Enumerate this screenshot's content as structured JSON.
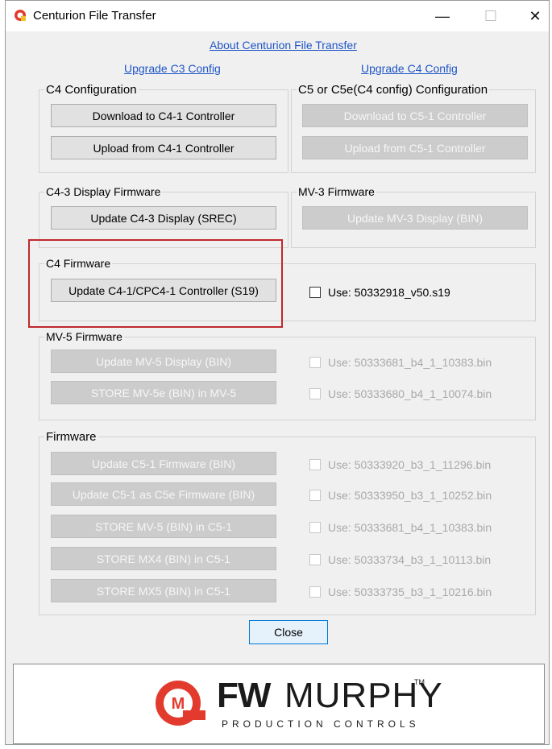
{
  "window": {
    "title": "Centurion File Transfer",
    "min_symbol": "—",
    "max_symbol": "☐",
    "close_symbol": "✕"
  },
  "links": {
    "about": "About Centurion File Transfer",
    "upgrade_c3": "Upgrade C3 Config",
    "upgrade_c4": "Upgrade C4 Config"
  },
  "c4_config": {
    "legend": "C4 Configuration",
    "download": "Download to C4-1 Controller",
    "upload": "Upload from C4-1 Controller"
  },
  "c5_config": {
    "legend": "C5 or C5e(C4 config) Configuration",
    "download": "Download to C5-1 Controller",
    "upload": "Upload from C5-1 Controller"
  },
  "c43_display": {
    "legend": "C4-3 Display Firmware",
    "update": "Update C4-3 Display (SREC)"
  },
  "mv3": {
    "legend": "MV-3 Firmware",
    "update": "Update MV-3 Display (BIN)"
  },
  "c4_firmware": {
    "legend": "C4 Firmware",
    "update": "Update C4-1/CPC4-1 Controller (S19)",
    "use": "Use: 50332918_v50.s19"
  },
  "mv5": {
    "legend": "MV-5 Firmware",
    "update": "Update MV-5 Display (BIN)",
    "update_use": "Use: 50333681_b4_1_10383.bin",
    "store": "STORE MV-5e (BIN) in MV-5",
    "store_use": "Use: 50333680_b4_1_10074.bin"
  },
  "firmware": {
    "legend": "Firmware",
    "rows": [
      {
        "button": "Update C5-1 Firmware (BIN)",
        "use": "Use: 50333920_b3_1_11296.bin"
      },
      {
        "button": "Update C5-1 as C5e Firmware (BIN)",
        "use": "Use: 50333950_b3_1_10252.bin"
      },
      {
        "button": "STORE MV-5 (BIN) in C5-1",
        "use": "Use: 50333681_b4_1_10383.bin"
      },
      {
        "button": "STORE MX4 (BIN) in C5-1",
        "use": "Use: 50333734_b3_1_10113.bin"
      },
      {
        "button": "STORE MX5 (BIN) in C5-1",
        "use": "Use: 50333735_b3_1_10216.bin"
      }
    ]
  },
  "close_label": "Close",
  "logo": {
    "fw": "FW",
    "murphy": "MURPHY",
    "tm": "TM",
    "tagline": "PRODUCTION CONTROLS",
    "mark_letter": "M"
  },
  "colors": {
    "link": "#1f55c7",
    "highlight": "#c0282d",
    "brand_red": "#e23b2e"
  }
}
